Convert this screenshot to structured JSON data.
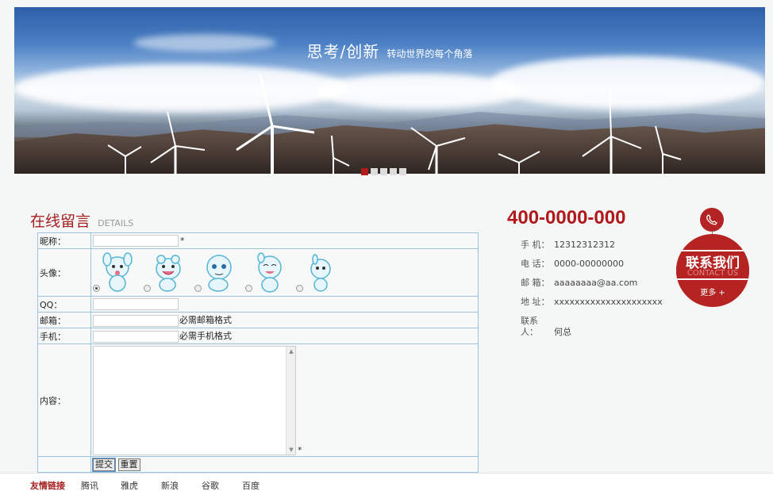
{
  "banner": {
    "title": "思考/创新",
    "subtitle": "转动世界的每个角落",
    "slides": 5,
    "active_slide": 1
  },
  "message_section": {
    "title": "在线留言",
    "title_en": "DETAILS",
    "fields": {
      "nickname_label": "昵称：",
      "nickname_required": "*",
      "avatar_label": "头像：",
      "avatars": [
        {
          "selected": true,
          "icon": "cartoon-avatar-1"
        },
        {
          "selected": false,
          "icon": "cartoon-avatar-2"
        },
        {
          "selected": false,
          "icon": "cartoon-avatar-3"
        },
        {
          "selected": false,
          "icon": "cartoon-avatar-4"
        },
        {
          "selected": false,
          "icon": "cartoon-avatar-5"
        }
      ],
      "qq_label": "QQ：",
      "email_label": "邮箱：",
      "email_hint": "必需邮箱格式",
      "mobile_label": "手机：",
      "mobile_hint": "必需手机格式",
      "content_label": "内容：",
      "content_required": "*"
    },
    "buttons": {
      "submit": "提交",
      "reset": "重置"
    }
  },
  "contact": {
    "hotline": "400-0000-000",
    "rows": [
      {
        "key": "手  机：",
        "value": "12312312312"
      },
      {
        "key": "电  话：",
        "value": "0000-00000000"
      },
      {
        "key": "邮  箱：",
        "value": "aaaaaaaa@aa.com"
      },
      {
        "key": "地  址：",
        "value": "xxxxxxxxxxxxxxxxxxxxx"
      },
      {
        "key": "联系人：",
        "value": "何总"
      }
    ],
    "badge": {
      "title": "联系我们",
      "title_en": "CONTACT US",
      "more": "更多 +",
      "icon": "phone-icon"
    },
    "accent_color": "#b0181b"
  },
  "footer": {
    "label": "友情链接",
    "links": [
      "腾讯",
      "雅虎",
      "新浪",
      "谷歌",
      "百度"
    ]
  }
}
